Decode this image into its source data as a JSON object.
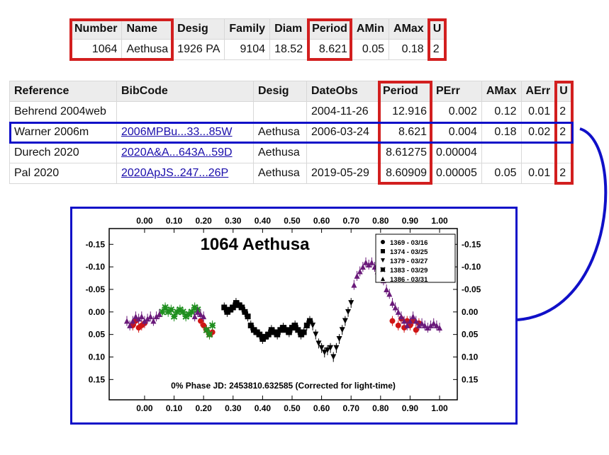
{
  "summary_table": {
    "headers": [
      "Number",
      "Name",
      "Desig",
      "Family",
      "Diam",
      "Period",
      "AMin",
      "AMax",
      "U"
    ],
    "row": [
      "1064",
      "Aethusa",
      "1926 PA",
      "9104",
      "18.52",
      "8.621",
      "0.05",
      "0.18",
      "2"
    ]
  },
  "lightcurve_table": {
    "headers": [
      "Reference",
      "BibCode",
      "Desig",
      "DateObs",
      "Period",
      "PErr",
      "AMax",
      "AErr",
      "U"
    ],
    "rows": [
      [
        "Behrend 2004web",
        "",
        "",
        "2004-11-26",
        "12.916",
        "0.002",
        "0.12",
        "0.01",
        "2"
      ],
      [
        "Warner 2006m",
        "2006MPBu...33...85W",
        "Aethusa",
        "2006-03-24",
        "8.621",
        "0.004",
        "0.18",
        "0.02",
        "2"
      ],
      [
        "Durech 2020",
        "2020A&A...643A..59D",
        "Aethusa",
        "",
        "8.61275",
        "0.00004",
        "",
        "",
        ""
      ],
      [
        "Pal 2020",
        "2020ApJS..247...26P",
        "Aethusa",
        "2019-05-29",
        "8.60909",
        "0.00005",
        "0.05",
        "0.01",
        "2"
      ]
    ]
  },
  "highlight_colors": {
    "red": "#d21f1f",
    "blue": "#1010c8"
  },
  "chart_data": {
    "type": "scatter",
    "title": "1064 Aethusa",
    "footer": "0% Phase JD:  2453810.632585   (Corrected for light-time)",
    "x_ticks": [
      "0.00",
      "0.10",
      "0.20",
      "0.30",
      "0.40",
      "0.50",
      "0.60",
      "0.70",
      "0.80",
      "0.90",
      "1.00"
    ],
    "y_ticks": [
      "-0.15",
      "-0.10",
      "-0.05",
      "0.00",
      "0.05",
      "0.10",
      "0.15"
    ],
    "xlim": [
      -0.12,
      1.06
    ],
    "ylim": [
      -0.185,
      0.195
    ],
    "y_inverted": true,
    "legend_position": "top-right",
    "series": [
      {
        "name": "1369 - 03/16",
        "marker": "circle",
        "color": "#d01515",
        "points": [
          [
            0.84,
            0.02
          ],
          [
            0.86,
            0.03
          ],
          [
            0.87,
            0.015
          ],
          [
            0.88,
            0.035
          ],
          [
            0.89,
            0.02
          ],
          [
            0.9,
            0.03
          ],
          [
            0.91,
            0.02
          ],
          [
            0.92,
            0.04
          ],
          [
            0.93,
            0.025
          ],
          [
            -0.04,
            0.03
          ],
          [
            -0.03,
            0.02
          ],
          [
            -0.02,
            0.035
          ],
          [
            -0.01,
            0.03
          ],
          [
            0.0,
            0.025
          ],
          [
            0.19,
            0.02
          ],
          [
            0.2,
            0.03
          ],
          [
            0.21,
            0.04
          ],
          [
            0.22,
            0.05
          ],
          [
            0.23,
            0.045
          ]
        ]
      },
      {
        "name": "1374 - 03/25",
        "marker": "square",
        "color": "#000000",
        "points": [
          [
            0.27,
            -0.01
          ],
          [
            0.28,
            0.0
          ],
          [
            0.29,
            -0.005
          ],
          [
            0.3,
            -0.01
          ],
          [
            0.31,
            -0.02
          ],
          [
            0.32,
            -0.015
          ],
          [
            0.33,
            -0.01
          ],
          [
            0.34,
            0.0
          ],
          [
            0.35,
            0.01
          ],
          [
            0.36,
            0.03
          ],
          [
            0.37,
            0.04
          ],
          [
            0.38,
            0.045
          ],
          [
            0.39,
            0.05
          ],
          [
            0.4,
            0.06
          ],
          [
            0.41,
            0.055
          ],
          [
            0.42,
            0.05
          ],
          [
            0.43,
            0.04
          ],
          [
            0.44,
            0.045
          ],
          [
            0.45,
            0.05
          ],
          [
            0.46,
            0.04
          ],
          [
            0.47,
            0.035
          ],
          [
            0.48,
            0.04
          ],
          [
            0.49,
            0.045
          ],
          [
            0.5,
            0.035
          ],
          [
            0.51,
            0.03
          ],
          [
            0.52,
            0.04
          ],
          [
            0.53,
            0.05
          ],
          [
            0.54,
            0.045
          ],
          [
            0.55,
            0.03
          ],
          [
            0.56,
            0.02
          ]
        ]
      },
      {
        "name": "1379 - 03/27",
        "marker": "triangle-down",
        "color": "#000000",
        "points": [
          [
            0.57,
            0.03
          ],
          [
            0.58,
            0.05
          ],
          [
            0.59,
            0.07
          ],
          [
            0.6,
            0.08
          ],
          [
            0.61,
            0.09
          ],
          [
            0.62,
            0.085
          ],
          [
            0.63,
            0.08
          ],
          [
            0.64,
            0.1
          ],
          [
            0.65,
            0.08
          ],
          [
            0.66,
            0.06
          ],
          [
            0.67,
            0.04
          ],
          [
            0.68,
            0.02
          ],
          [
            0.69,
            0.0
          ],
          [
            0.7,
            -0.02
          ]
        ]
      },
      {
        "name": "1383 - 03/29",
        "marker": "asterisk",
        "color": "#1f8f1f",
        "points": [
          [
            0.06,
            0.0
          ],
          [
            0.07,
            -0.01
          ],
          [
            0.08,
            0.0
          ],
          [
            0.09,
            -0.005
          ],
          [
            0.1,
            0.01
          ],
          [
            0.11,
            0.0
          ],
          [
            0.12,
            -0.005
          ],
          [
            0.13,
            0.0
          ],
          [
            0.14,
            0.01
          ],
          [
            0.15,
            0.005
          ],
          [
            0.16,
            0.0
          ],
          [
            0.17,
            -0.01
          ],
          [
            0.18,
            -0.005
          ],
          [
            0.21,
            0.04
          ],
          [
            0.22,
            0.05
          ],
          [
            0.23,
            0.03
          ]
        ]
      },
      {
        "name": "1386 - 03/31",
        "marker": "triangle-up",
        "color": "#6a1a7a",
        "points": [
          [
            0.71,
            -0.06
          ],
          [
            0.72,
            -0.08
          ],
          [
            0.73,
            -0.09
          ],
          [
            0.74,
            -0.1
          ],
          [
            0.75,
            -0.11
          ],
          [
            0.76,
            -0.105
          ],
          [
            0.77,
            -0.11
          ],
          [
            0.78,
            -0.1
          ],
          [
            0.79,
            -0.09
          ],
          [
            0.8,
            -0.08
          ],
          [
            0.81,
            -0.07
          ],
          [
            0.82,
            -0.05
          ],
          [
            0.83,
            -0.04
          ],
          [
            0.84,
            -0.02
          ],
          [
            0.85,
            -0.01
          ],
          [
            0.86,
            0.0
          ],
          [
            0.87,
            0.01
          ],
          [
            0.88,
            0.02
          ],
          [
            0.89,
            0.03
          ],
          [
            0.9,
            0.02
          ],
          [
            0.91,
            0.01
          ],
          [
            0.92,
            0.02
          ],
          [
            0.93,
            0.03
          ],
          [
            0.94,
            0.025
          ],
          [
            0.95,
            0.03
          ],
          [
            0.96,
            0.035
          ],
          [
            0.97,
            0.03
          ],
          [
            0.98,
            0.025
          ],
          [
            0.99,
            0.03
          ],
          [
            1.0,
            0.035
          ],
          [
            -0.06,
            0.02
          ],
          [
            -0.05,
            0.03
          ],
          [
            -0.04,
            0.02
          ],
          [
            -0.03,
            0.01
          ],
          [
            -0.02,
            0.015
          ],
          [
            -0.01,
            0.01
          ],
          [
            0.0,
            0.02
          ],
          [
            0.01,
            0.015
          ],
          [
            0.02,
            0.01
          ],
          [
            0.03,
            0.02
          ],
          [
            0.04,
            0.01
          ],
          [
            0.05,
            0.005
          ],
          [
            0.17,
            0.01
          ],
          [
            0.18,
            0.0
          ],
          [
            0.19,
            0.005
          ],
          [
            0.2,
            0.01
          ]
        ]
      }
    ]
  }
}
